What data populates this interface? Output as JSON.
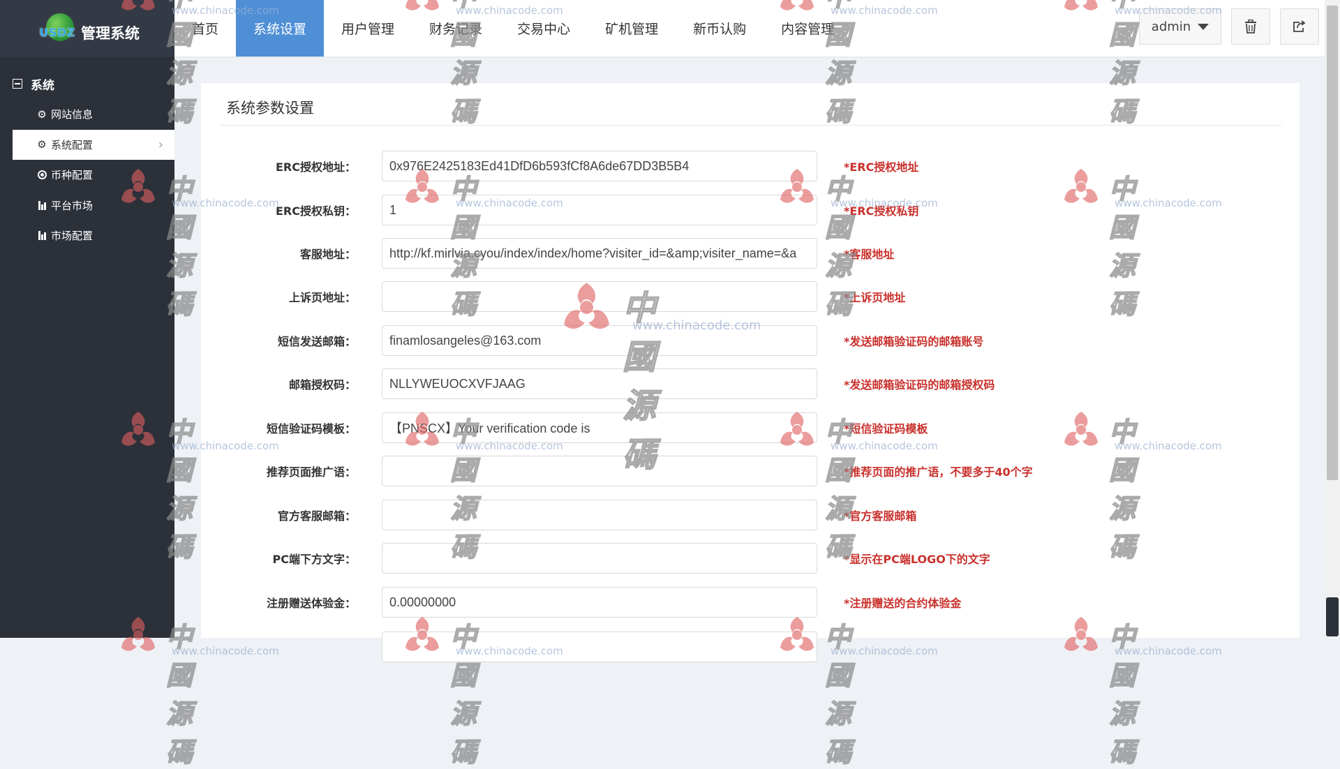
{
  "brand": {
    "logo_letters": "USDZ",
    "title": "管理系统"
  },
  "sidebar": {
    "section_label": "系统",
    "items": [
      {
        "label": "网站信息",
        "icon": "gear-icon"
      },
      {
        "label": "系统配置",
        "icon": "gear-icon"
      },
      {
        "label": "币种配置",
        "icon": "target-icon"
      },
      {
        "label": "平台市场",
        "icon": "bar-chart-icon"
      },
      {
        "label": "市场配置",
        "icon": "bar-chart-icon"
      }
    ]
  },
  "nav": {
    "items": [
      "首页",
      "系统设置",
      "用户管理",
      "财务记录",
      "交易中心",
      "矿机管理",
      "新币认购",
      "内容管理"
    ],
    "active": "系统设置"
  },
  "header": {
    "user": "admin"
  },
  "page": {
    "title": "系统参数设置"
  },
  "form": [
    {
      "label": "ERC授权地址：",
      "value": "0x976E2425183Ed41DfD6b593fCf8A6de67DD3B5B4",
      "hint": "*ERC授权地址"
    },
    {
      "label": "ERC授权私钥：",
      "value": "1",
      "hint": "*ERC授权私钥"
    },
    {
      "label": "客服地址：",
      "value": "http://kf.mirlvia.cyou/index/index/home?visiter_id=&amp;visiter_name=&a",
      "hint": "*客服地址"
    },
    {
      "label": "上诉页地址：",
      "value": "",
      "hint": "*上诉页地址"
    },
    {
      "label": "短信发送邮箱：",
      "value": "finamlosangeles@163.com",
      "hint": "*发送邮箱验证码的邮箱账号"
    },
    {
      "label": "邮箱授权码：",
      "value": "NLLYWEUOCXVFJAAG",
      "hint": "*发送邮箱验证码的邮箱授权码"
    },
    {
      "label": "短信验证码模板：",
      "value": "【PNSCX】Your verification code is",
      "hint": "*短信验证码模板"
    },
    {
      "label": "推荐页面推广语：",
      "value": "",
      "hint": "*推荐页面的推广语，不要多于40个字"
    },
    {
      "label": "官方客服邮箱：",
      "value": "",
      "hint": "*官方客服邮箱"
    },
    {
      "label": "PC端下方文字：",
      "value": "",
      "hint": "*显示在PC端LOGO下的文字"
    },
    {
      "label": "注册赠送体验金：",
      "value": "0.00000000",
      "hint": "*注册赠送的合约体验金"
    }
  ],
  "watermark": {
    "text": "中國源碼",
    "url": "www.chinacode.com"
  },
  "colors": {
    "sidebar_bg": "#2b3039",
    "nav_active": "#4e8fd6",
    "hint_red": "#c9302c"
  }
}
